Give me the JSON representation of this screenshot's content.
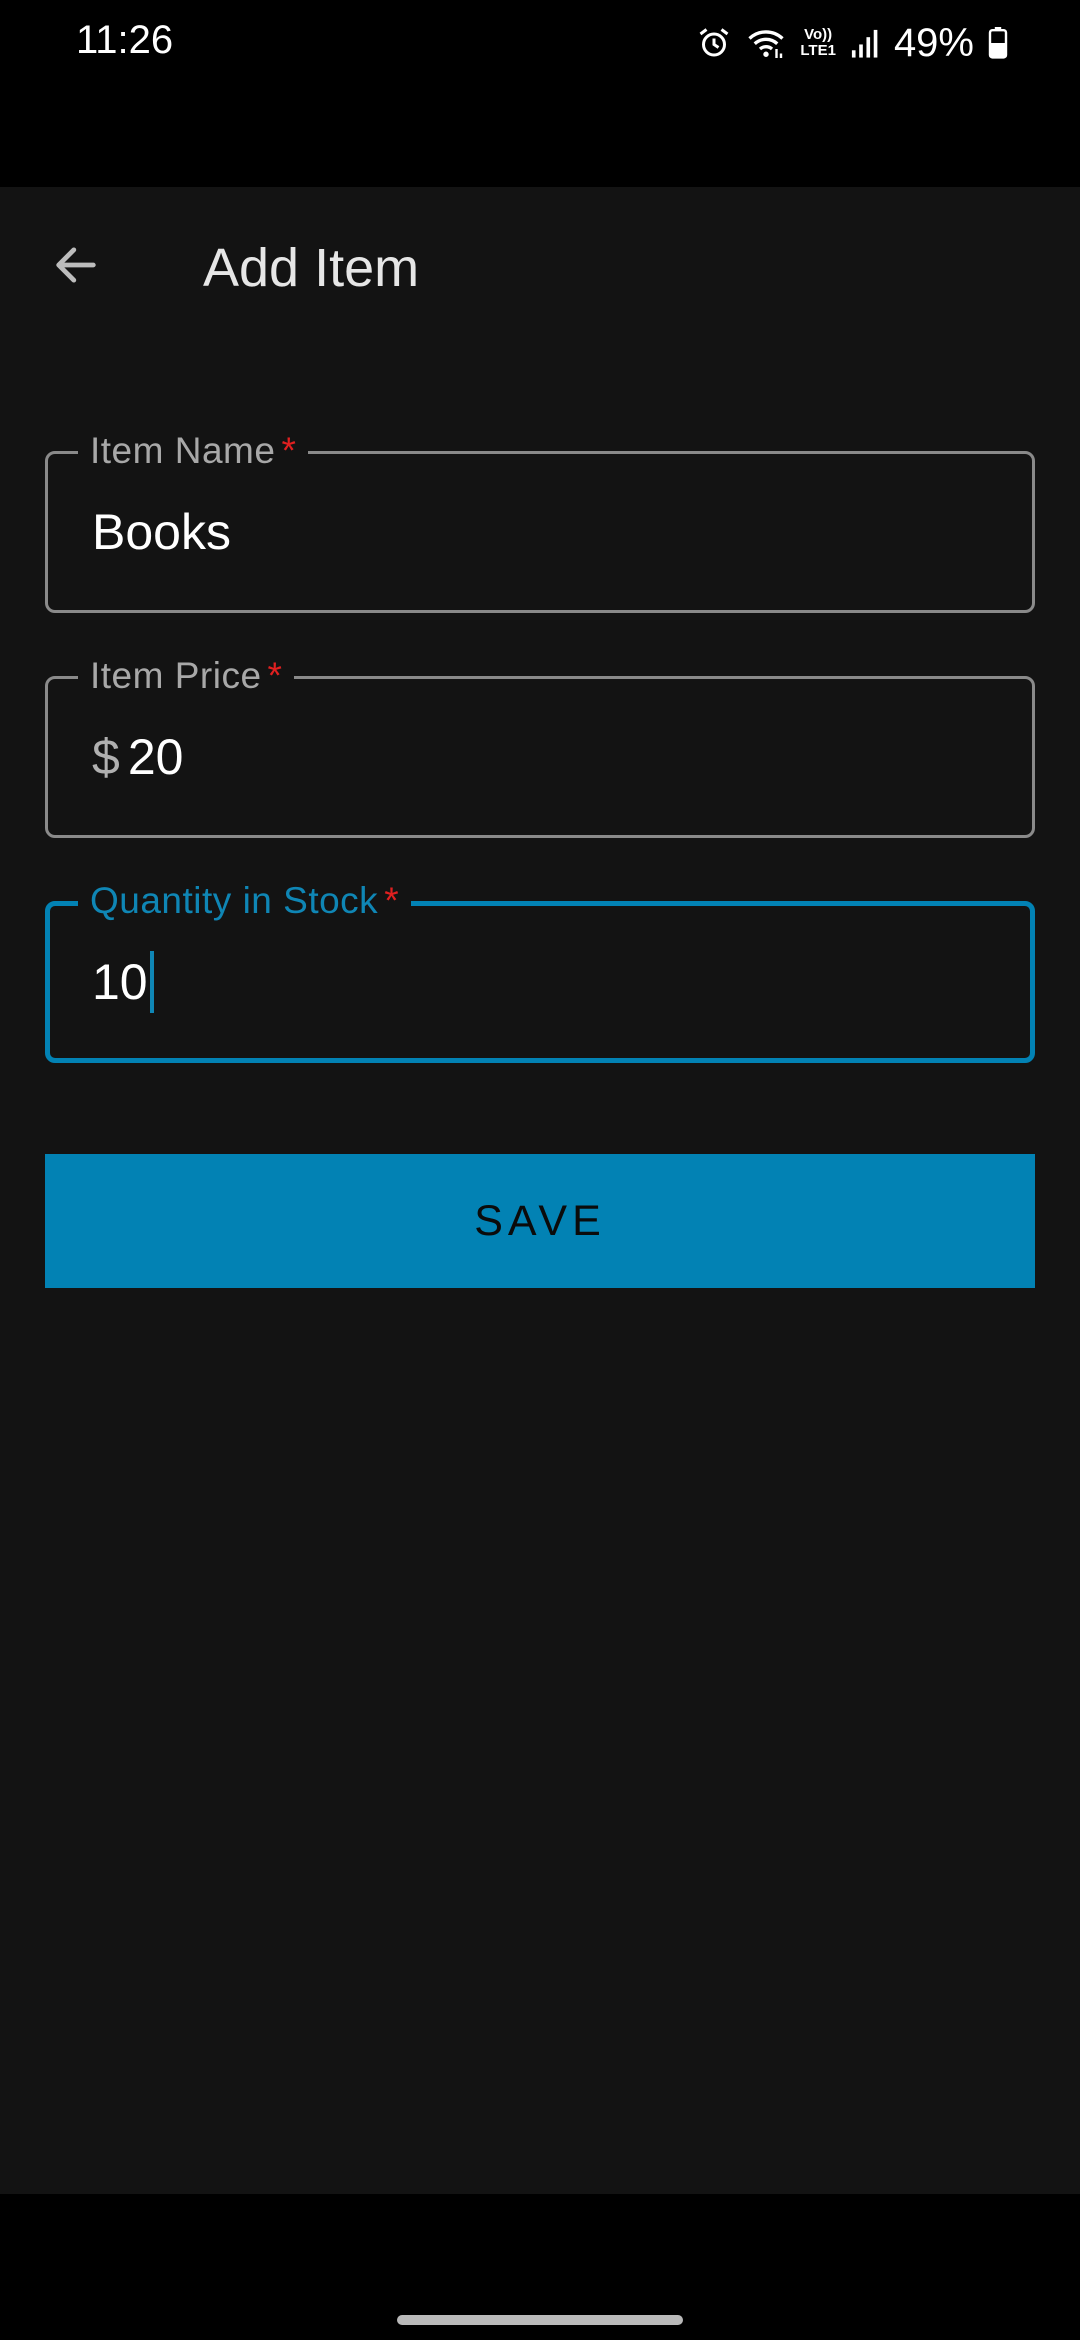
{
  "status_bar": {
    "time": "11:26",
    "volte_line1": "Vo))",
    "volte_line2": "LTE1",
    "battery_percent": "49%",
    "icons": [
      "alarm-icon",
      "wifi-icon",
      "volte-icon",
      "signal-icon",
      "battery-icon"
    ]
  },
  "app_bar": {
    "title": "Add Item",
    "back_icon": "arrow-back-icon"
  },
  "form": {
    "item_name": {
      "label": "Item Name",
      "required_mark": "*",
      "value": "Books"
    },
    "item_price": {
      "label": "Item Price",
      "required_mark": "*",
      "prefix": "$",
      "value": "20"
    },
    "quantity": {
      "label": "Quantity in Stock",
      "required_mark": "*",
      "value": "10",
      "focused": true
    }
  },
  "save_button": {
    "label": "SAVE"
  },
  "colors": {
    "background": "#131313",
    "accent": "#0282b4",
    "required": "#e02020",
    "outline": "#8a8a8a"
  }
}
